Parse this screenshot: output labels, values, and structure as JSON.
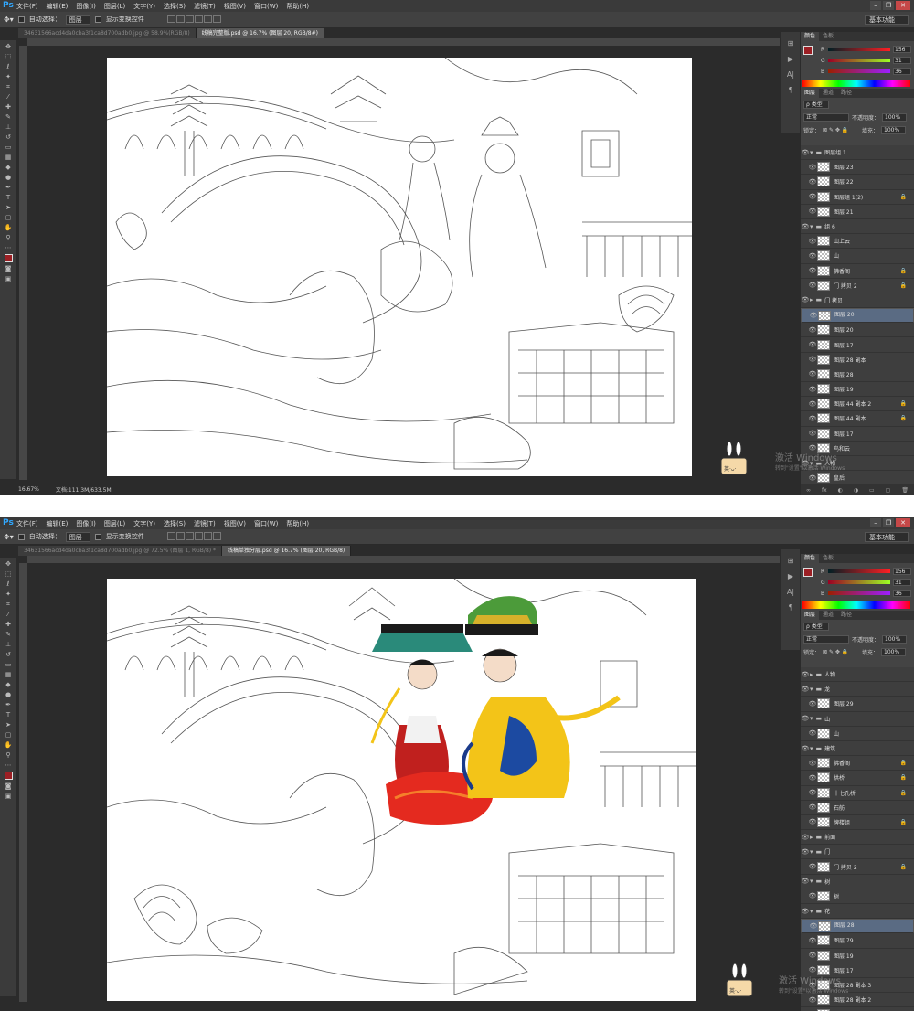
{
  "windows": [
    {
      "app_logo": "Ps",
      "menu": [
        "文件(F)",
        "编辑(E)",
        "图像(I)",
        "图层(L)",
        "文字(Y)",
        "选择(S)",
        "滤镜(T)",
        "视图(V)",
        "窗口(W)",
        "帮助(H)"
      ],
      "options": {
        "auto_select": "自动选择：",
        "target": "图层",
        "show_transform": "显示变换控件",
        "workspace": "基本功能"
      },
      "tabs": [
        "34631566acd4da0cba3f1ca8d700adb0.jpg @ 58.9%(RGB/8)",
        "线稿完整版.psd @ 16.7% (图层 20, RGB/8#)"
      ],
      "status": {
        "zoom": "16.67%",
        "doc": "文档:111.3M/633.5M"
      },
      "color_panel": {
        "tabs": [
          "颜色",
          "色板"
        ],
        "r": "156",
        "g": "31",
        "b": "36",
        "labels": [
          "R",
          "G",
          "B"
        ]
      },
      "layers_panel": {
        "tabs": [
          "图层",
          "通道",
          "路径"
        ],
        "filter": "ρ 类型",
        "blend": "正常",
        "opacity_label": "不透明度：",
        "opacity": "100%",
        "lock_label": "锁定：",
        "fill_label": "填充：",
        "fill": "100%",
        "layers": [
          {
            "name": "图层组 1",
            "folder": true,
            "open": true
          },
          {
            "name": "图层 23"
          },
          {
            "name": "图层 22"
          },
          {
            "name": "图层组 1(2)",
            "lock": true
          },
          {
            "name": "图层 21"
          },
          {
            "name": "组 6",
            "folder": true,
            "open": true
          },
          {
            "name": "山上云"
          },
          {
            "name": "山"
          },
          {
            "name": "佛香阁",
            "lock": true
          },
          {
            "name": "门 拷贝 2",
            "lock": true
          },
          {
            "name": "门 拷贝",
            "folder": true
          },
          {
            "name": "图层 20",
            "selected": true
          },
          {
            "name": "图层 20"
          },
          {
            "name": "图层 17"
          },
          {
            "name": "图层 28 副本"
          },
          {
            "name": "图层 28"
          },
          {
            "name": "图层 19"
          },
          {
            "name": "图层 44 副本 2",
            "lock": true
          },
          {
            "name": "图层 44 副本",
            "lock": true
          },
          {
            "name": "图层 17"
          },
          {
            "name": "鸟和云"
          },
          {
            "name": "人物",
            "folder": true,
            "open": true
          },
          {
            "name": "皇后"
          },
          {
            "name": "贵妃脸"
          }
        ]
      },
      "watermark": {
        "line1": "激活 Windows",
        "line2": "转到\"设置\"以激活 Windows"
      },
      "mascot_text": "英·ᴗ·"
    },
    {
      "app_logo": "Ps",
      "menu": [
        "文件(F)",
        "编辑(E)",
        "图像(I)",
        "图层(L)",
        "文字(Y)",
        "选择(S)",
        "滤镜(T)",
        "视图(V)",
        "窗口(W)",
        "帮助(H)"
      ],
      "options": {
        "auto_select": "自动选择：",
        "target": "图层",
        "show_transform": "显示变换控件",
        "workspace": "基本功能"
      },
      "tabs": [
        "34631566acd4da0cba3f1ca8d700adb0.jpg @ 72.5% (图层 1, RGB/8) *",
        "线稿单独分层.psd @ 16.7% (图层 20, RGB/8)"
      ],
      "status": {
        "zoom": "",
        "doc": ""
      },
      "color_panel": {
        "tabs": [
          "颜色",
          "色板"
        ],
        "r": "156",
        "g": "31",
        "b": "36",
        "labels": [
          "R",
          "G",
          "B"
        ]
      },
      "layers_panel": {
        "tabs": [
          "图层",
          "通道",
          "路径"
        ],
        "filter": "ρ 类型",
        "blend": "正常",
        "opacity_label": "不透明度：",
        "opacity": "100%",
        "lock_label": "锁定：",
        "fill_label": "填充：",
        "fill": "100%",
        "layers": [
          {
            "name": "人物",
            "folder": true
          },
          {
            "name": "龙",
            "folder": true,
            "open": true
          },
          {
            "name": "图层 29"
          },
          {
            "name": "山",
            "folder": true,
            "open": true
          },
          {
            "name": "山"
          },
          {
            "name": "建筑",
            "folder": true,
            "open": true
          },
          {
            "name": "佛香阁",
            "lock": true
          },
          {
            "name": "拱桥",
            "lock": true
          },
          {
            "name": "十七孔桥",
            "lock": true
          },
          {
            "name": "石舫"
          },
          {
            "name": "牌楼组",
            "lock": true
          },
          {
            "name": "前面",
            "folder": true
          },
          {
            "name": "门",
            "folder": true,
            "open": true
          },
          {
            "name": "门 拷贝 2",
            "lock": true
          },
          {
            "name": "树",
            "folder": true,
            "open": true
          },
          {
            "name": "树"
          },
          {
            "name": "花",
            "folder": true,
            "open": true
          },
          {
            "name": "图层 28",
            "selected": true
          },
          {
            "name": "图层 79"
          },
          {
            "name": "图层 19"
          },
          {
            "name": "图层 17"
          },
          {
            "name": "图层 28 副本 3"
          },
          {
            "name": "图层 28 副本 2"
          },
          {
            "name": "图层 28 副本"
          },
          {
            "name": "图层 25"
          }
        ]
      },
      "watermark": {
        "line1": "激活 Windows",
        "line2": "转到\"设置\"以激活 Windows"
      },
      "mascot_text": "英·ᴗ·"
    }
  ],
  "colors": {
    "fg": "#9c1f24",
    "selected_layer": "#5a6b83",
    "ps_blue": "#31a8ff"
  }
}
